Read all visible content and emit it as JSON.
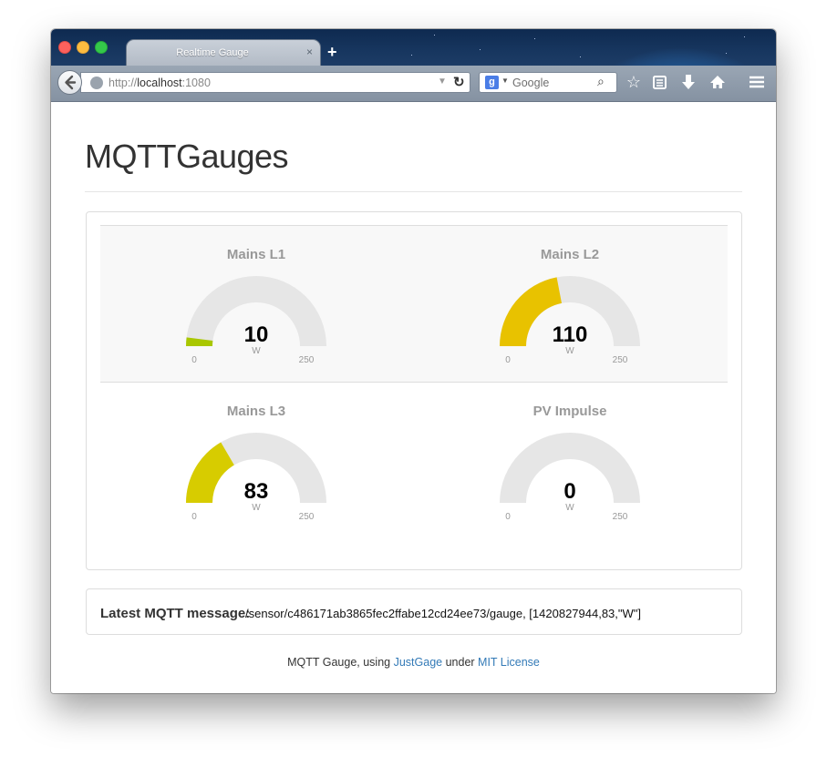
{
  "window": {
    "tab_title": "Realtime Gauge",
    "tab_close": "×",
    "new_tab": "+"
  },
  "navbar": {
    "url_prefix": "http://",
    "url_host": "localhost",
    "url_suffix": ":1080",
    "search_engine_glyph": "g",
    "search_placeholder": "Google"
  },
  "page": {
    "title": "MQTTGauges"
  },
  "gauges": [
    {
      "title": "Mains L1",
      "value": "10",
      "unit": "W",
      "min": "0",
      "max": "250",
      "color": "#a9c700"
    },
    {
      "title": "Mains L2",
      "value": "110",
      "unit": "W",
      "min": "0",
      "max": "250",
      "color": "#e8c200"
    },
    {
      "title": "Mains L3",
      "value": "83",
      "unit": "W",
      "min": "0",
      "max": "250",
      "color": "#d7cc00"
    },
    {
      "title": "PV Impulse",
      "value": "0",
      "unit": "W",
      "min": "0",
      "max": "250",
      "color": "#a9c700"
    }
  ],
  "gauge_track_color": "#e6e6e6",
  "message": {
    "label": "Latest MQTT message:",
    "text": "/sensor/c486171ab3865fec2ffabe12cd24ee73/gauge, [1420827944,83,\"W\"]"
  },
  "footer": {
    "prefix": "MQTT Gauge, using ",
    "link1": "JustGage",
    "middle": " under ",
    "link2": "MIT License"
  },
  "icons": {
    "back": "back-arrow-icon",
    "bookmark": "star-icon",
    "reading_list": "clipboard-icon",
    "downloads": "download-arrow-icon",
    "home": "home-icon",
    "menu": "hamburger-menu-icon"
  }
}
